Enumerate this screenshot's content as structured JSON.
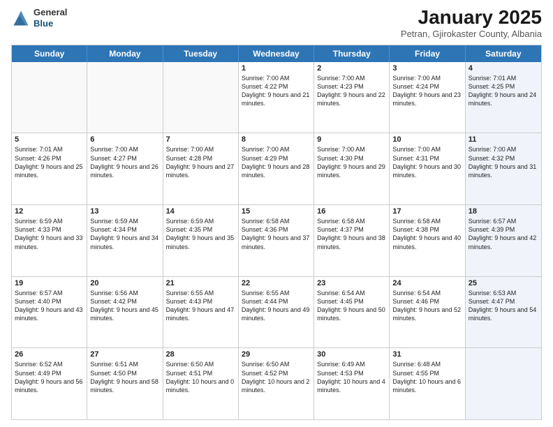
{
  "logo": {
    "general": "General",
    "blue": "Blue"
  },
  "title": "January 2025",
  "subtitle": "Petran, Gjirokaster County, Albania",
  "days_of_week": [
    "Sunday",
    "Monday",
    "Tuesday",
    "Wednesday",
    "Thursday",
    "Friday",
    "Saturday"
  ],
  "weeks": [
    [
      {
        "day": "",
        "info": "",
        "shaded": false,
        "empty": true
      },
      {
        "day": "",
        "info": "",
        "shaded": false,
        "empty": true
      },
      {
        "day": "",
        "info": "",
        "shaded": false,
        "empty": true
      },
      {
        "day": "1",
        "info": "Sunrise: 7:00 AM\nSunset: 4:22 PM\nDaylight: 9 hours and 21 minutes.",
        "shaded": false,
        "empty": false
      },
      {
        "day": "2",
        "info": "Sunrise: 7:00 AM\nSunset: 4:23 PM\nDaylight: 9 hours and 22 minutes.",
        "shaded": false,
        "empty": false
      },
      {
        "day": "3",
        "info": "Sunrise: 7:00 AM\nSunset: 4:24 PM\nDaylight: 9 hours and 23 minutes.",
        "shaded": false,
        "empty": false
      },
      {
        "day": "4",
        "info": "Sunrise: 7:01 AM\nSunset: 4:25 PM\nDaylight: 9 hours and 24 minutes.",
        "shaded": true,
        "empty": false
      }
    ],
    [
      {
        "day": "5",
        "info": "Sunrise: 7:01 AM\nSunset: 4:26 PM\nDaylight: 9 hours and 25 minutes.",
        "shaded": false,
        "empty": false
      },
      {
        "day": "6",
        "info": "Sunrise: 7:00 AM\nSunset: 4:27 PM\nDaylight: 9 hours and 26 minutes.",
        "shaded": false,
        "empty": false
      },
      {
        "day": "7",
        "info": "Sunrise: 7:00 AM\nSunset: 4:28 PM\nDaylight: 9 hours and 27 minutes.",
        "shaded": false,
        "empty": false
      },
      {
        "day": "8",
        "info": "Sunrise: 7:00 AM\nSunset: 4:29 PM\nDaylight: 9 hours and 28 minutes.",
        "shaded": false,
        "empty": false
      },
      {
        "day": "9",
        "info": "Sunrise: 7:00 AM\nSunset: 4:30 PM\nDaylight: 9 hours and 29 minutes.",
        "shaded": false,
        "empty": false
      },
      {
        "day": "10",
        "info": "Sunrise: 7:00 AM\nSunset: 4:31 PM\nDaylight: 9 hours and 30 minutes.",
        "shaded": false,
        "empty": false
      },
      {
        "day": "11",
        "info": "Sunrise: 7:00 AM\nSunset: 4:32 PM\nDaylight: 9 hours and 31 minutes.",
        "shaded": true,
        "empty": false
      }
    ],
    [
      {
        "day": "12",
        "info": "Sunrise: 6:59 AM\nSunset: 4:33 PM\nDaylight: 9 hours and 33 minutes.",
        "shaded": false,
        "empty": false
      },
      {
        "day": "13",
        "info": "Sunrise: 6:59 AM\nSunset: 4:34 PM\nDaylight: 9 hours and 34 minutes.",
        "shaded": false,
        "empty": false
      },
      {
        "day": "14",
        "info": "Sunrise: 6:59 AM\nSunset: 4:35 PM\nDaylight: 9 hours and 35 minutes.",
        "shaded": false,
        "empty": false
      },
      {
        "day": "15",
        "info": "Sunrise: 6:58 AM\nSunset: 4:36 PM\nDaylight: 9 hours and 37 minutes.",
        "shaded": false,
        "empty": false
      },
      {
        "day": "16",
        "info": "Sunrise: 6:58 AM\nSunset: 4:37 PM\nDaylight: 9 hours and 38 minutes.",
        "shaded": false,
        "empty": false
      },
      {
        "day": "17",
        "info": "Sunrise: 6:58 AM\nSunset: 4:38 PM\nDaylight: 9 hours and 40 minutes.",
        "shaded": false,
        "empty": false
      },
      {
        "day": "18",
        "info": "Sunrise: 6:57 AM\nSunset: 4:39 PM\nDaylight: 9 hours and 42 minutes.",
        "shaded": true,
        "empty": false
      }
    ],
    [
      {
        "day": "19",
        "info": "Sunrise: 6:57 AM\nSunset: 4:40 PM\nDaylight: 9 hours and 43 minutes.",
        "shaded": false,
        "empty": false
      },
      {
        "day": "20",
        "info": "Sunrise: 6:56 AM\nSunset: 4:42 PM\nDaylight: 9 hours and 45 minutes.",
        "shaded": false,
        "empty": false
      },
      {
        "day": "21",
        "info": "Sunrise: 6:55 AM\nSunset: 4:43 PM\nDaylight: 9 hours and 47 minutes.",
        "shaded": false,
        "empty": false
      },
      {
        "day": "22",
        "info": "Sunrise: 6:55 AM\nSunset: 4:44 PM\nDaylight: 9 hours and 49 minutes.",
        "shaded": false,
        "empty": false
      },
      {
        "day": "23",
        "info": "Sunrise: 6:54 AM\nSunset: 4:45 PM\nDaylight: 9 hours and 50 minutes.",
        "shaded": false,
        "empty": false
      },
      {
        "day": "24",
        "info": "Sunrise: 6:54 AM\nSunset: 4:46 PM\nDaylight: 9 hours and 52 minutes.",
        "shaded": false,
        "empty": false
      },
      {
        "day": "25",
        "info": "Sunrise: 6:53 AM\nSunset: 4:47 PM\nDaylight: 9 hours and 54 minutes.",
        "shaded": true,
        "empty": false
      }
    ],
    [
      {
        "day": "26",
        "info": "Sunrise: 6:52 AM\nSunset: 4:49 PM\nDaylight: 9 hours and 56 minutes.",
        "shaded": false,
        "empty": false
      },
      {
        "day": "27",
        "info": "Sunrise: 6:51 AM\nSunset: 4:50 PM\nDaylight: 9 hours and 58 minutes.",
        "shaded": false,
        "empty": false
      },
      {
        "day": "28",
        "info": "Sunrise: 6:50 AM\nSunset: 4:51 PM\nDaylight: 10 hours and 0 minutes.",
        "shaded": false,
        "empty": false
      },
      {
        "day": "29",
        "info": "Sunrise: 6:50 AM\nSunset: 4:52 PM\nDaylight: 10 hours and 2 minutes.",
        "shaded": false,
        "empty": false
      },
      {
        "day": "30",
        "info": "Sunrise: 6:49 AM\nSunset: 4:53 PM\nDaylight: 10 hours and 4 minutes.",
        "shaded": false,
        "empty": false
      },
      {
        "day": "31",
        "info": "Sunrise: 6:48 AM\nSunset: 4:55 PM\nDaylight: 10 hours and 6 minutes.",
        "shaded": false,
        "empty": false
      },
      {
        "day": "",
        "info": "",
        "shaded": true,
        "empty": true
      }
    ]
  ]
}
